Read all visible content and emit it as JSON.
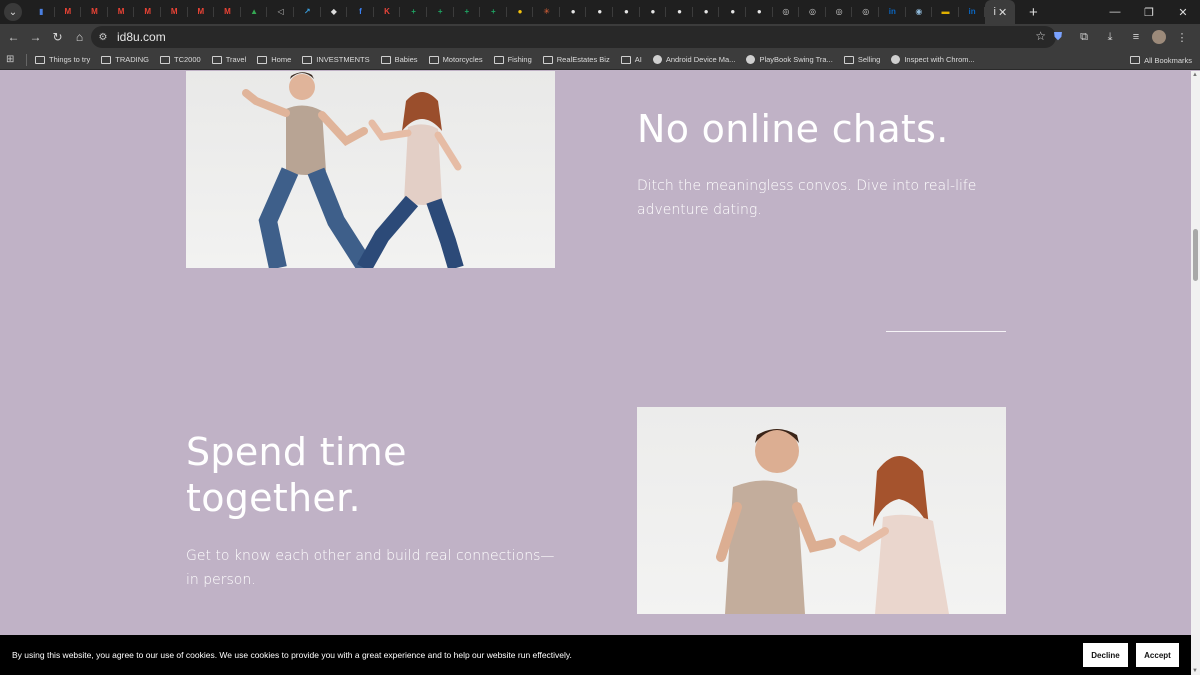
{
  "browser": {
    "favicons": [
      {
        "icon": "google-docs-icon",
        "glyph": "▮",
        "color": "#4a7fe0"
      },
      {
        "icon": "gmail-icon",
        "glyph": "M",
        "color": "#ea4335"
      },
      {
        "icon": "gmail-icon",
        "glyph": "M",
        "color": "#ea4335"
      },
      {
        "icon": "gmail-icon",
        "glyph": "M",
        "color": "#ea4335"
      },
      {
        "icon": "gmail-icon",
        "glyph": "M",
        "color": "#ea4335"
      },
      {
        "icon": "gmail-icon",
        "glyph": "M",
        "color": "#ea4335"
      },
      {
        "icon": "gmail-icon",
        "glyph": "M",
        "color": "#ea4335"
      },
      {
        "icon": "gmail-icon",
        "glyph": "M",
        "color": "#ea4335"
      },
      {
        "icon": "google-drive-icon",
        "glyph": "▲",
        "color": "#34a853"
      },
      {
        "icon": "audio-icon",
        "glyph": "◁",
        "color": "#bbbbbb"
      },
      {
        "icon": "chart-icon",
        "glyph": "↗",
        "color": "#3aa0e0"
      },
      {
        "icon": "shield-icon",
        "glyph": "◆",
        "color": "#dddddd"
      },
      {
        "icon": "facebook-icon",
        "glyph": "f",
        "color": "#3b82f6"
      },
      {
        "icon": "app-red-icon",
        "glyph": "K",
        "color": "#e8443a"
      },
      {
        "icon": "sheets-icon",
        "glyph": "+",
        "color": "#1ea362"
      },
      {
        "icon": "sheets-icon",
        "glyph": "+",
        "color": "#1ea362"
      },
      {
        "icon": "sheets-green-icon",
        "glyph": "+",
        "color": "#1ea362"
      },
      {
        "icon": "sheets-icon",
        "glyph": "+",
        "color": "#1ea362"
      },
      {
        "icon": "sun-icon",
        "glyph": "●",
        "color": "#f4c20d"
      },
      {
        "icon": "sparkle-icon",
        "glyph": "✳",
        "color": "#e8663a"
      },
      {
        "icon": "github-icon",
        "glyph": "●",
        "color": "#e6e6e6"
      },
      {
        "icon": "github-icon",
        "glyph": "●",
        "color": "#e6e6e6"
      },
      {
        "icon": "github-icon",
        "glyph": "●",
        "color": "#e6e6e6"
      },
      {
        "icon": "github-icon",
        "glyph": "●",
        "color": "#e6e6e6"
      },
      {
        "icon": "github-icon",
        "glyph": "●",
        "color": "#e6e6e6"
      },
      {
        "icon": "github-icon",
        "glyph": "●",
        "color": "#e6e6e6"
      },
      {
        "icon": "github-icon",
        "glyph": "●",
        "color": "#e6e6e6"
      },
      {
        "icon": "github-icon",
        "glyph": "●",
        "color": "#e6e6e6"
      },
      {
        "icon": "globe-icon",
        "glyph": "◎",
        "color": "#cfcfcf"
      },
      {
        "icon": "globe-icon",
        "glyph": "◎",
        "color": "#cfcfcf"
      },
      {
        "icon": "globe-icon",
        "glyph": "◎",
        "color": "#cfcfcf"
      },
      {
        "icon": "globe-icon",
        "glyph": "◎",
        "color": "#cfcfcf"
      },
      {
        "icon": "linkedin-icon",
        "glyph": "in",
        "color": "#0a66c2"
      },
      {
        "icon": "globe-icon",
        "glyph": "◉",
        "color": "#8fb8d8"
      },
      {
        "icon": "flag-icon",
        "glyph": "▬",
        "color": "#e0b000"
      },
      {
        "icon": "linkedin-icon",
        "glyph": "in",
        "color": "#0a66c2"
      }
    ],
    "active_tab_label": "i",
    "url": "id8u.com",
    "bookmarks": [
      {
        "label": "Things to try",
        "type": "folder"
      },
      {
        "label": "TRADING",
        "type": "folder"
      },
      {
        "label": "TC2000",
        "type": "folder"
      },
      {
        "label": "Travel",
        "type": "folder"
      },
      {
        "label": "Home",
        "type": "folder"
      },
      {
        "label": "INVESTMENTS",
        "type": "folder"
      },
      {
        "label": "Babies",
        "type": "folder"
      },
      {
        "label": "Motorcycles",
        "type": "folder"
      },
      {
        "label": "Fishing",
        "type": "folder"
      },
      {
        "label": "RealEstates Biz",
        "type": "folder"
      },
      {
        "label": "AI",
        "type": "folder"
      },
      {
        "label": "Android Device Ma...",
        "type": "link"
      },
      {
        "label": "PlayBook Swing Tra...",
        "type": "link"
      },
      {
        "label": "Selling",
        "type": "folder"
      },
      {
        "label": "Inspect with Chrom...",
        "type": "link"
      }
    ],
    "all_bookmarks_label": "All Bookmarks"
  },
  "page": {
    "section1": {
      "heading": "No online chats.",
      "body": "Ditch the meaningless convos. Dive into real-life adventure dating."
    },
    "section2": {
      "heading": "Spend time together.",
      "body": "Get to know each other and build real connections—in person."
    },
    "colors": {
      "background": "#c0b2c6",
      "text": "#ffffff"
    }
  },
  "cookie_banner": {
    "text": "By using this website, you agree to our use of cookies. We use cookies to provide you with a great experience and to help our website run effectively.",
    "decline_label": "Decline",
    "accept_label": "Accept"
  }
}
